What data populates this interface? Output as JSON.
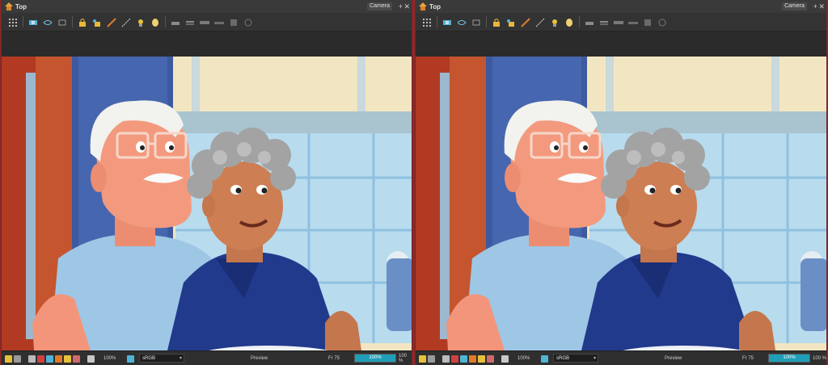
{
  "colors": {
    "accent": "#1f9fb7",
    "window_border": "#8a2a2a",
    "panel_bg": "#2e2e2e"
  },
  "panels": [
    {
      "tab": "Top",
      "view_select": "Camera",
      "status": {
        "zoom_left": "100%",
        "color_space": "sRGB",
        "preview_label": "Preview",
        "frame_label": "Fr 75",
        "progress": 1.0,
        "progress_text": "100%",
        "zoom_right": "100 %"
      }
    },
    {
      "tab": "Top",
      "view_select": "Camera",
      "status": {
        "zoom_left": "100%",
        "color_space": "sRGB",
        "preview_label": "Preview",
        "frame_label": "Fr 75",
        "progress": 1.0,
        "progress_text": "100%",
        "zoom_right": "100 %"
      }
    }
  ],
  "toolbar_icons": [
    "grid-icon",
    "camera-mask-icon",
    "onion-skin-icon",
    "light-table-icon",
    "lock-icon",
    "lock-drawing-icon",
    "brush-icon",
    "line-icon",
    "light-icon",
    "bulb-icon",
    "layer-icon",
    "layers-icon",
    "keyframe-icon",
    "ease-icon",
    "timing-icon",
    "sequence-icon"
  ],
  "status_icons": [
    "light-icon",
    "camera-icon",
    "grid-icon",
    "safe-area-icon",
    "onion-skin-icon",
    "render-icon",
    "flash-icon",
    "shape-icon",
    "palette-icon",
    "rgb-icon"
  ]
}
